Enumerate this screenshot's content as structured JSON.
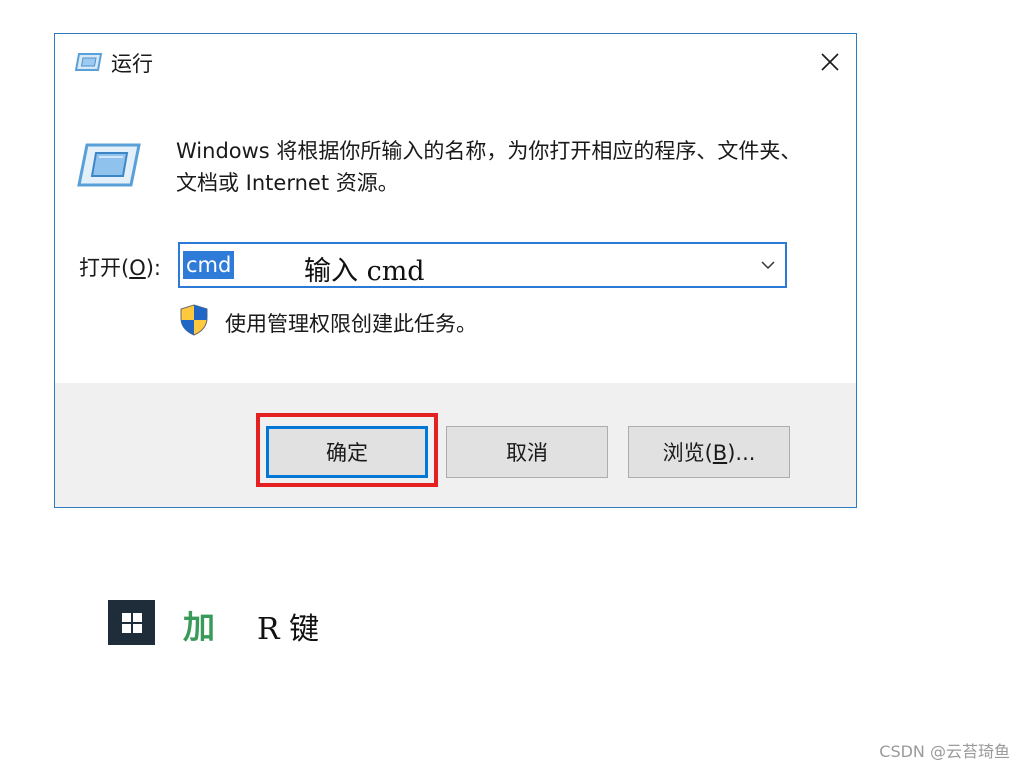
{
  "dialog": {
    "title": "运行",
    "description": "Windows 将根据你所输入的名称，为你打开相应的程序、文件夹、文档或 Internet 资源。",
    "open_label": "打开(",
    "open_label_key": "O",
    "open_label_end": "):",
    "input_value": "cmd",
    "input_annotation": "输入 cmd",
    "admin_note": "使用管理权限创建此任务。",
    "buttons": {
      "ok_label": "确定",
      "cancel_label": "取消",
      "browse_label": "浏览(",
      "browse_key": "B",
      "browse_end": ")..."
    }
  },
  "hint": {
    "plus": "加",
    "key": "R 键"
  },
  "watermark": "CSDN @云苔琦鱼",
  "icons": {
    "title": "run-icon",
    "close": "close-icon",
    "dropdown": "chevron-down-icon",
    "shield": "shield-icon",
    "windows_key": "windows-logo-icon"
  },
  "colors": {
    "accent": "#0078d7",
    "selection": "#2f7bd8",
    "highlight": "#e52020",
    "hint_green": "#3a9a5a"
  }
}
